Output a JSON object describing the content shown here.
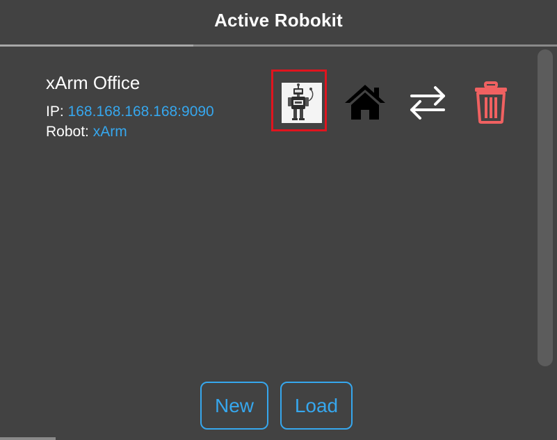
{
  "header": {
    "title": "Active Robokit"
  },
  "robokit": {
    "name": "xArm Office",
    "ip_label": "IP:",
    "ip_value": "168.168.168.168:9090",
    "robot_label": "Robot:",
    "robot_value": "xArm"
  },
  "actions": {
    "robot_icon": "robot-icon",
    "home_icon": "home-icon",
    "swap_icon": "swap-arrows-icon",
    "delete_icon": "trash-icon"
  },
  "buttons": {
    "new_label": "New",
    "load_label": "Load"
  },
  "colors": {
    "background": "#424242",
    "accent": "#36a7ee",
    "selection": "#e0141e",
    "delete": "#f06161"
  }
}
